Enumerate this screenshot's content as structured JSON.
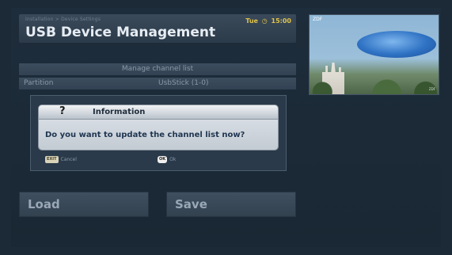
{
  "header": {
    "breadcrumb": "Installation > Device Settings",
    "title": "USB Device Management",
    "clock_day": "Tue",
    "clock_icon": "clock-icon",
    "clock_time": "15:00"
  },
  "preview": {
    "channel_logo": "ZDF",
    "watermark": "ZDF"
  },
  "channel_list_bar": {
    "label": "Manage channel list"
  },
  "partition": {
    "label": "Partition",
    "value": "UsbStick (1-0)"
  },
  "dialog": {
    "icon": "question-icon",
    "icon_glyph": "?",
    "title": "Information",
    "message": "Do you want to update the channel list now?"
  },
  "actions": {
    "cancel_key": "EXIT",
    "cancel_label": "Cancel",
    "ok_key": "OK",
    "ok_label": "Ok"
  },
  "buttons": {
    "load": "Load",
    "save": "Save"
  },
  "colors": {
    "background": "#1c2a38",
    "accent": "#e0c24a",
    "dialog": "#dfe4ea"
  }
}
